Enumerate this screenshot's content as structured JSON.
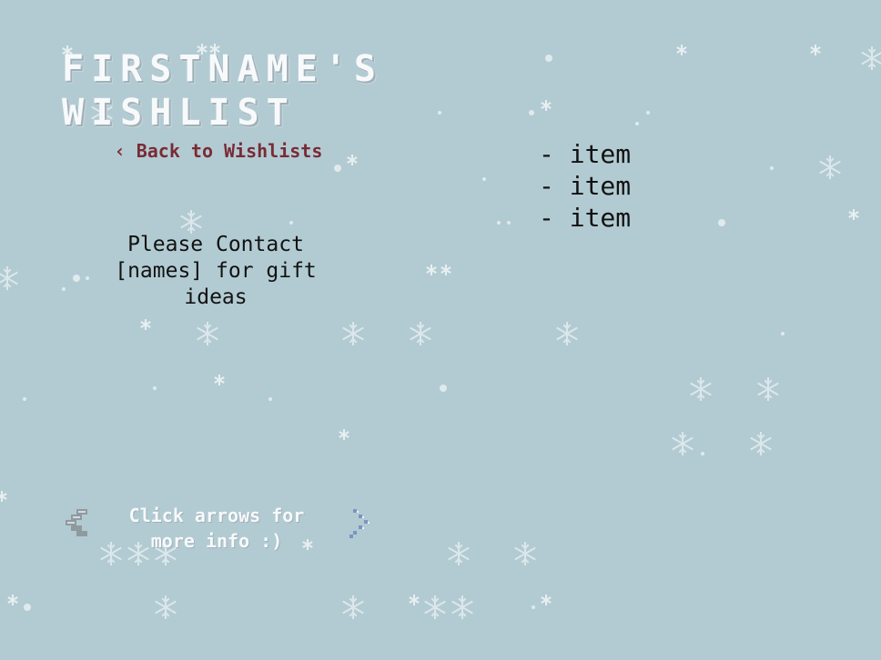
{
  "page": {
    "title": "FIRSTNAME'S WISHLIST",
    "back_link": "‹ Back to Wishlists",
    "contact_text": "Please Contact [names] for gift ideas",
    "hint": "Click arrows for more info :)"
  },
  "wishlist": {
    "items": [
      "- item",
      "- item",
      "- item"
    ]
  },
  "icons": {
    "prev": "arrow-left-icon",
    "next": "arrow-right-icon",
    "background": "snowflake-icon"
  },
  "colors": {
    "background": "#b2cbd2",
    "title": "#f7f9fb",
    "link": "#7a2b34",
    "body_text": "#121212"
  }
}
